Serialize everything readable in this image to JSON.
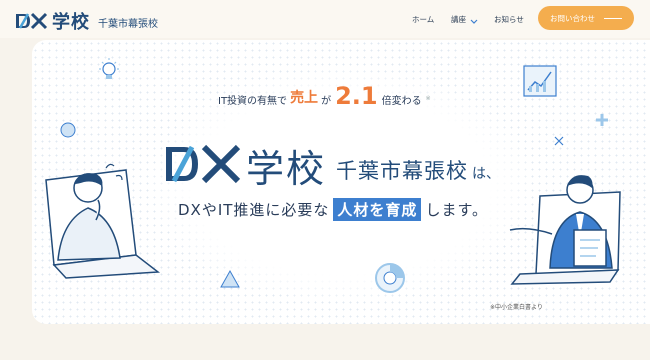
{
  "header": {
    "logo_school": "学校",
    "logo_sub": "千葉市幕張校",
    "nav": {
      "home": "ホーム",
      "course": "講座",
      "news": "お知らせ"
    },
    "contact_label": "お問い合わせ",
    "colors": {
      "navy": "#234c7a",
      "accent": "#f4ad4e"
    }
  },
  "hero": {
    "tagline": {
      "prefix": "IT投資の有無で",
      "sales": "売上",
      "ga": "が",
      "number": "2.1",
      "suffix": "倍変わる",
      "note_mark": "※"
    },
    "title": {
      "school": "学校",
      "city": "千葉市幕張校",
      "ha": "は、"
    },
    "subline": {
      "pre": "DXやIT推進に必要な",
      "highlight": "人材を育成",
      "post": "します。"
    },
    "footnote": "※中小企業白書より",
    "colors": {
      "orange": "#ee7b3a",
      "highlight_bg": "#3d7fcf"
    }
  },
  "icons": [
    "dx-logo-icon",
    "chevron-down-icon",
    "lightbulb-icon",
    "chart-icon",
    "person-thinking-illustration",
    "person-presenting-illustration"
  ]
}
